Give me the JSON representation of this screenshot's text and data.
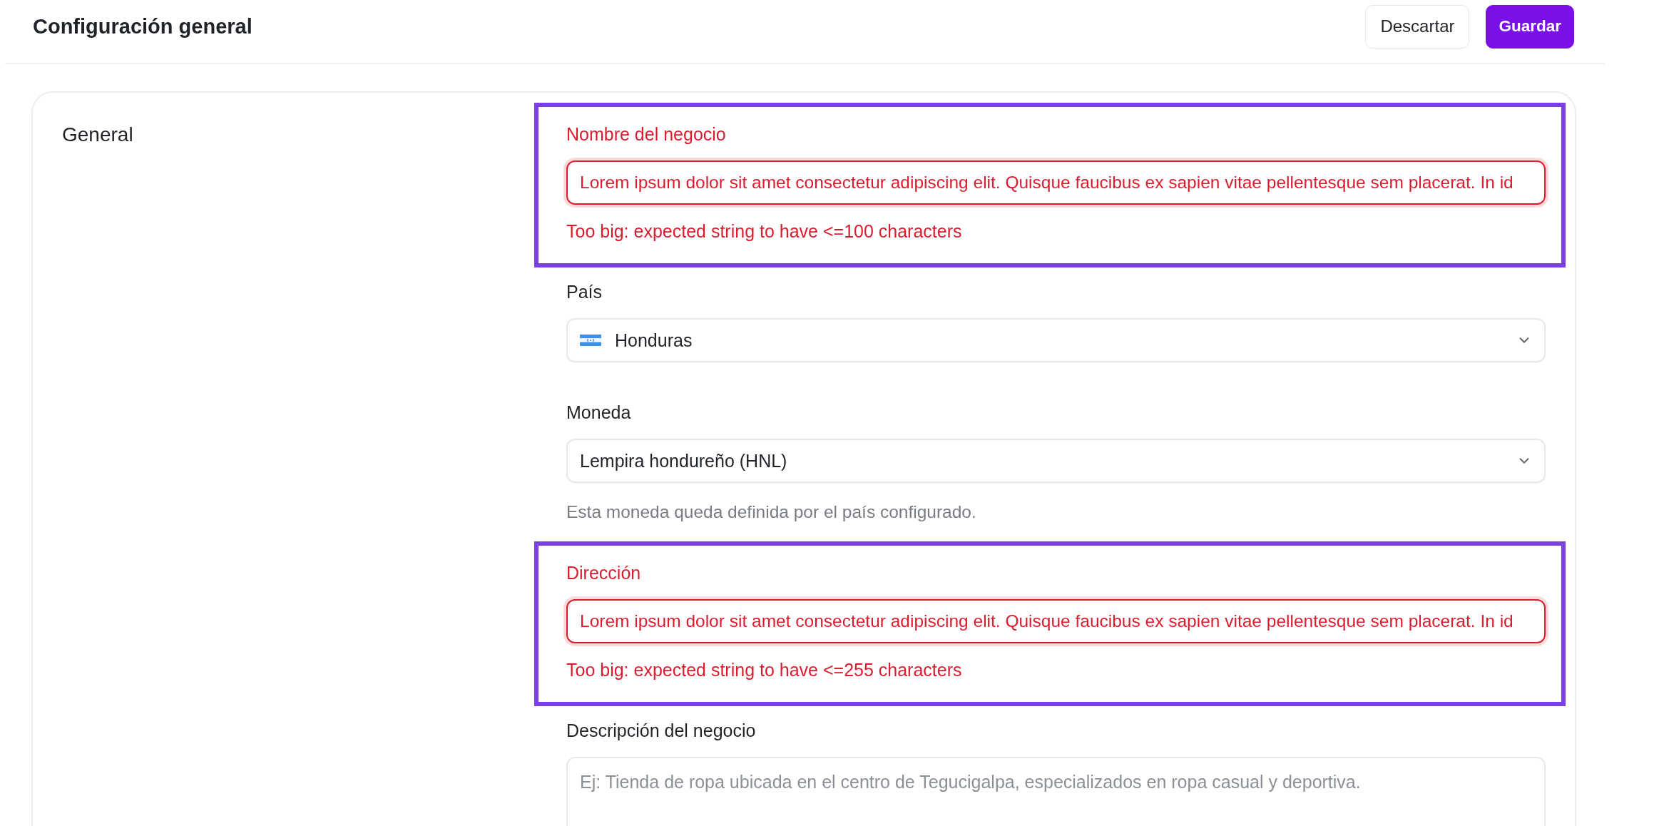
{
  "header": {
    "title": "Configuración general",
    "buttons": [
      {
        "label": "Descartar",
        "kind": "secondary"
      },
      {
        "label": "Guardar",
        "kind": "primary"
      }
    ]
  },
  "section": {
    "title": "General",
    "fields": [
      {
        "kind": "text",
        "label": "Nombre del negocio",
        "value": "Lorem ipsum dolor sit amet consectetur adipiscing elit. Quisque faucibus ex sapien vitae pellentesque sem placerat. In id",
        "error": "Too big: expected string to have <=100 characters",
        "invalid": true,
        "highlighted": true
      },
      {
        "kind": "country-select",
        "label": "País",
        "value": "Honduras",
        "invalid": false,
        "highlighted": false
      },
      {
        "kind": "select",
        "label": "Moneda",
        "value": "Lempira hondureño (HNL)",
        "help": "Esta moneda queda definida por el país configurado.",
        "invalid": false,
        "highlighted": false
      },
      {
        "kind": "text",
        "label": "Dirección",
        "value": "Lorem ipsum dolor sit amet consectetur adipiscing elit. Quisque faucibus ex sapien vitae pellentesque sem placerat. In id",
        "error": "Too big: expected string to have <=255 characters",
        "invalid": true,
        "highlighted": true
      },
      {
        "kind": "textarea",
        "label": "Descripción del negocio",
        "placeholder": "Ej: Tienda de ropa ubicada en el centro de Tegucigalpa, especializados en ropa casual y deportiva.",
        "invalid": false,
        "highlighted": false
      }
    ]
  }
}
